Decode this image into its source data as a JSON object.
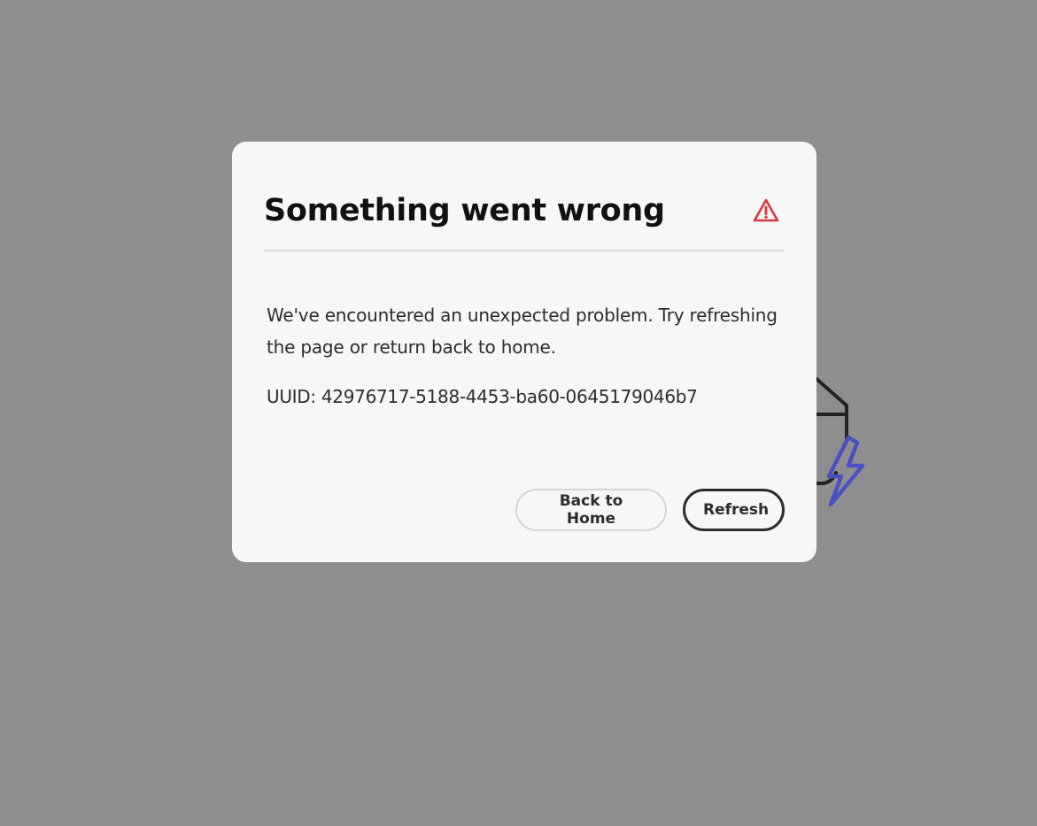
{
  "dialog": {
    "title": "Something went wrong",
    "icon": "alert-triangle-icon",
    "message": "We've encountered an unexpected problem. Try refreshing the page or return back to home.",
    "uuid": "UUID: 42976717-5188-4453-ba60-0645179046b7",
    "buttons": {
      "back_home": "Back to Home",
      "refresh": "Refresh"
    }
  },
  "colors": {
    "overlay": "#8e8e8e",
    "dialog_bg": "#f7f7f7",
    "alert": "#d7373f",
    "illustration_accent": "#4b4fc4"
  }
}
